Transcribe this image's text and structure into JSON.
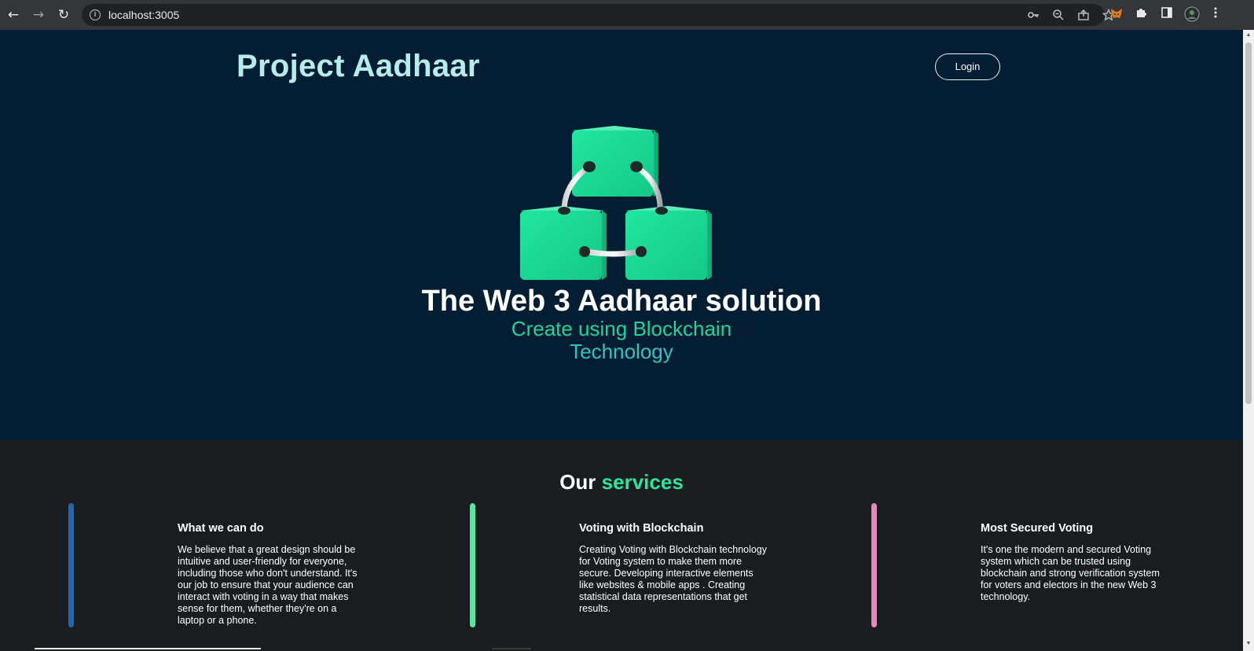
{
  "browser": {
    "url": "localhost:3005",
    "back_icon": "←",
    "forward_icon": "→",
    "reload_icon": "↻",
    "info_icon": "i"
  },
  "header": {
    "brand": "Project Aadhaar",
    "login_label": "Login"
  },
  "hero": {
    "title": "The Web 3 Aadhaar solution",
    "subtitle_line1": "Create using Blockchain",
    "subtitle_line2": "Technology"
  },
  "services": {
    "title_prefix": "Our",
    "title_accent": "services",
    "cards": [
      {
        "title": "What we can do",
        "text": "We believe that a great design should be intuitive and user-friendly for everyone, including those who don't understand. It's our job to ensure that your audience can interact with voting in a way that makes sense for them, whether they're on a laptop or a phone.",
        "color": "#1e66b8"
      },
      {
        "title": "Voting with Blockchain",
        "text": "Creating Voting with Blockchain technology for Voting system to make them more secure. Developing interactive elements like websites & mobile apps . Creating statistical data representations that get results.",
        "color": "#5ee3a0"
      },
      {
        "title": "Most Secured Voting",
        "text": "It's one the modern and secured Voting system which can be trusted using blockchain and strong verification system for voters and electors in the new Web 3 technology.",
        "color": "#e986c0"
      }
    ]
  },
  "colors": {
    "hero_bg": "#031e32",
    "services_bg": "#1a1c20",
    "brand": "#b7ecec",
    "accent_green": "#2ee59d",
    "cube_green": "#1fdc97"
  }
}
